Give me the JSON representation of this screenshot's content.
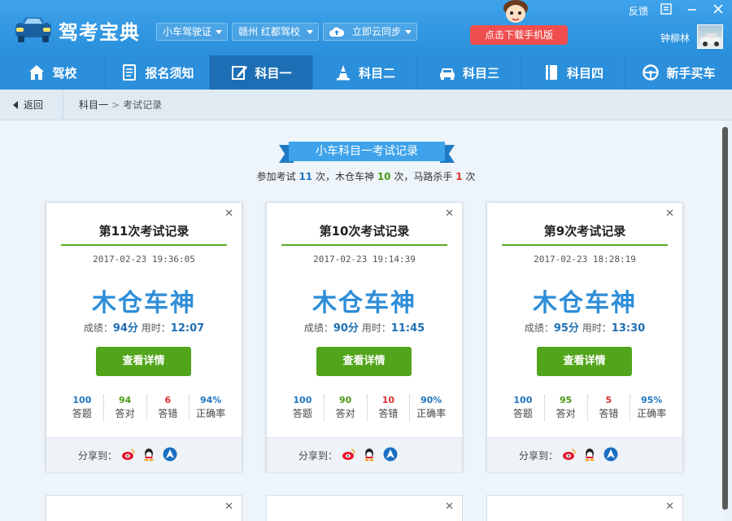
{
  "app": {
    "title": "驾考宝典"
  },
  "titlebar": {
    "license_type": "小车驾驶证",
    "school": "赣州 红都驾校",
    "sync": "立即云同步",
    "download": "点击下载手机版",
    "feedback": "反馈",
    "username": "钟柳林"
  },
  "nav": {
    "items": [
      {
        "label": "驾校",
        "icon": "school-icon"
      },
      {
        "label": "报名须知",
        "icon": "document-icon"
      },
      {
        "label": "科目一",
        "icon": "edit-icon"
      },
      {
        "label": "科目二",
        "icon": "cone-icon"
      },
      {
        "label": "科目三",
        "icon": "car-icon"
      },
      {
        "label": "科目四",
        "icon": "book-icon"
      },
      {
        "label": "新手买车",
        "icon": "steering-wheel-icon"
      }
    ],
    "active": "科目一"
  },
  "breadcrumb": {
    "back": "返回",
    "parent": "科目一",
    "sep": ">",
    "current": "考试记录"
  },
  "header": {
    "ribbon": "小车科目一考试记录",
    "summary_prefix": "参加考试",
    "exam_count": "11",
    "unit1": "次，木仓车神",
    "master_count": "10",
    "unit2": "次，马路杀手",
    "killer_count": "1",
    "unit3": "次"
  },
  "cards": [
    {
      "title": "第11次考试记录",
      "date": "2017-02-23 19:36:05",
      "verdict": "木仓车神",
      "score_label": "成绩：",
      "score": "94分",
      "time_label": "用时：",
      "time": "12:07",
      "button": "查看详情",
      "stats": [
        {
          "n": "100",
          "l": "答题"
        },
        {
          "n": "94",
          "l": "答对"
        },
        {
          "n": "6",
          "l": "答错"
        },
        {
          "n": "94%",
          "l": "正确率"
        }
      ],
      "share": "分享到："
    },
    {
      "title": "第10次考试记录",
      "date": "2017-02-23 19:14:39",
      "verdict": "木仓车神",
      "score_label": "成绩：",
      "score": "90分",
      "time_label": "用时：",
      "time": "11:45",
      "button": "查看详情",
      "stats": [
        {
          "n": "100",
          "l": "答题"
        },
        {
          "n": "90",
          "l": "答对"
        },
        {
          "n": "10",
          "l": "答错"
        },
        {
          "n": "90%",
          "l": "正确率"
        }
      ],
      "share": "分享到："
    },
    {
      "title": "第9次考试记录",
      "date": "2017-02-23 18:28:19",
      "verdict": "木仓车神",
      "score_label": "成绩：",
      "score": "95分",
      "time_label": "用时：",
      "time": "13:30",
      "button": "查看详情",
      "stats": [
        {
          "n": "100",
          "l": "答题"
        },
        {
          "n": "95",
          "l": "答对"
        },
        {
          "n": "5",
          "l": "答错"
        },
        {
          "n": "95%",
          "l": "正确率"
        }
      ],
      "share": "分享到："
    }
  ],
  "colors": {
    "brand": "#2b8fdc",
    "active_nav": "#1d6fb5",
    "button_green": "#52a51b",
    "verdict_blue": "#2e8ed8",
    "download_red": "#f04e4e"
  }
}
